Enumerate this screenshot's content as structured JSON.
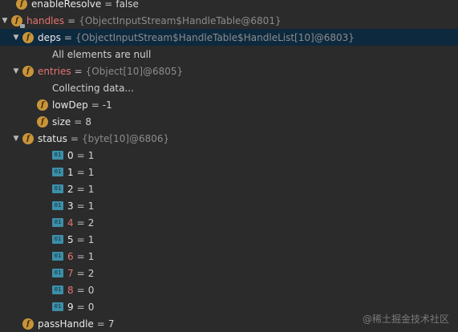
{
  "rows": [
    {
      "indent": 20,
      "arrow": false,
      "icon": "f",
      "name": "enableResolve",
      "red": false,
      "value": "false",
      "ref": "",
      "selected": false
    },
    {
      "indent": 10,
      "arrow": true,
      "icon": "f",
      "lock": true,
      "name": "handles",
      "red": true,
      "value": "",
      "ref": "{ObjectInputStream$HandleTable@6801}",
      "selected": false
    },
    {
      "indent": 28,
      "arrow": true,
      "icon": "f",
      "name": "deps",
      "red": false,
      "value": "",
      "ref": "{ObjectInputStream$HandleTable$HandleList[10]@6803}",
      "selected": true
    },
    {
      "indent": 65,
      "message": "All elements are null"
    },
    {
      "indent": 28,
      "arrow": true,
      "icon": "f",
      "name": "entries",
      "red": true,
      "value": "",
      "ref": "{Object[10]@6805}",
      "selected": false
    },
    {
      "indent": 65,
      "message": "Collecting data..."
    },
    {
      "indent": 46,
      "arrow": false,
      "icon": "f",
      "name": "lowDep",
      "red": false,
      "value": "-1",
      "ref": "",
      "selected": false
    },
    {
      "indent": 46,
      "arrow": false,
      "icon": "f",
      "name": "size",
      "red": false,
      "value": "8",
      "ref": "",
      "selected": false
    },
    {
      "indent": 28,
      "arrow": true,
      "icon": "f",
      "name": "status",
      "red": false,
      "value": "",
      "ref": "{byte[10]@6806}",
      "selected": false
    },
    {
      "indent": 65,
      "icon": "a",
      "name": "0",
      "red": false,
      "value": "1"
    },
    {
      "indent": 65,
      "icon": "a",
      "name": "1",
      "red": false,
      "value": "1"
    },
    {
      "indent": 65,
      "icon": "a",
      "name": "2",
      "red": false,
      "value": "1"
    },
    {
      "indent": 65,
      "icon": "a",
      "name": "3",
      "red": false,
      "value": "1"
    },
    {
      "indent": 65,
      "icon": "a",
      "name": "4",
      "red": true,
      "value": "2"
    },
    {
      "indent": 65,
      "icon": "a",
      "name": "5",
      "red": false,
      "value": "1"
    },
    {
      "indent": 65,
      "icon": "a",
      "name": "6",
      "red": true,
      "value": "1"
    },
    {
      "indent": 65,
      "icon": "a",
      "name": "7",
      "red": true,
      "value": "2"
    },
    {
      "indent": 65,
      "icon": "a",
      "name": "8",
      "red": true,
      "value": "0"
    },
    {
      "indent": 65,
      "icon": "a",
      "name": "9",
      "red": false,
      "value": "0"
    },
    {
      "indent": 28,
      "arrow": false,
      "icon": "f",
      "name": "passHandle",
      "red": false,
      "value": "7",
      "ref": "",
      "selected": false
    }
  ],
  "icons": {
    "field": "f",
    "array_element": "01"
  },
  "colors": {
    "background": "#2b2b2b",
    "selected": "#0d293e",
    "modified": "#e57373",
    "field_icon": "#c9943a",
    "array_icon": "#3d8fa8"
  },
  "watermark": "@稀土掘金技术社区"
}
